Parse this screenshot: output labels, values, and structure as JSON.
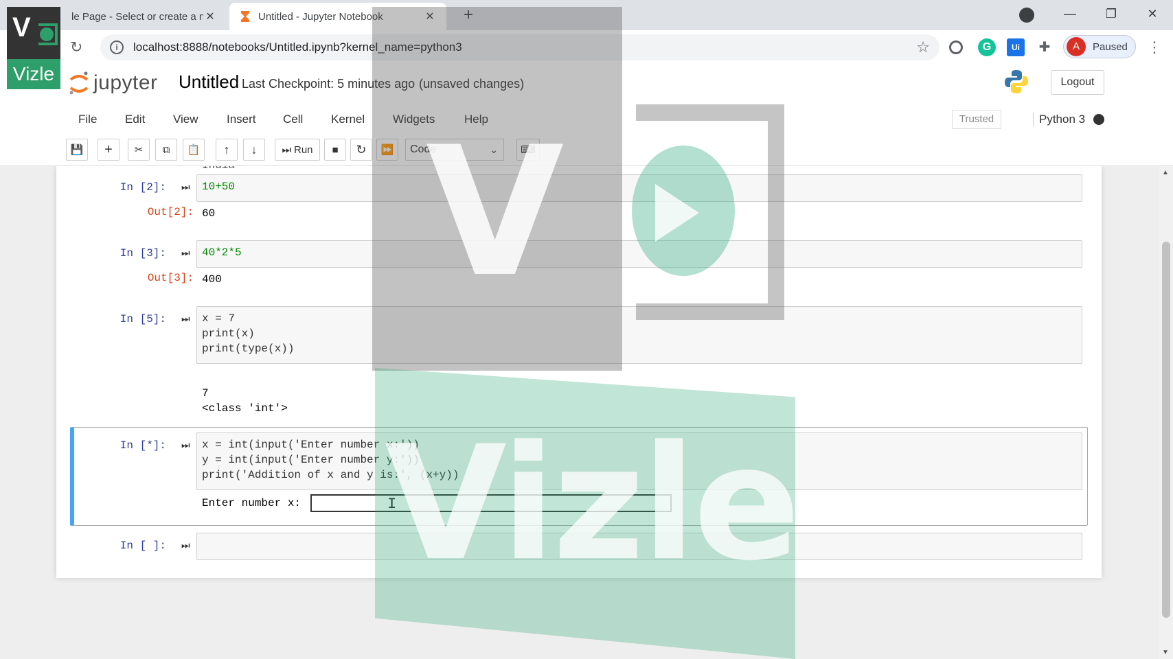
{
  "browser": {
    "tabs": [
      {
        "title": "le Page - Select or create a n",
        "active": false
      },
      {
        "title": "Untitled - Jupyter Notebook",
        "active": true
      }
    ],
    "url": "localhost:8888/notebooks/Untitled.ipynb?kernel_name=python3",
    "profile_status": "Paused",
    "profile_initial": "A"
  },
  "jupyter": {
    "logo_text": "jupyter",
    "notebook_title": "Untitled",
    "checkpoint": "Last Checkpoint: 5 minutes ago",
    "unsaved": "(unsaved changes)",
    "logout_label": "Logout",
    "menu": [
      "File",
      "Edit",
      "View",
      "Insert",
      "Cell",
      "Kernel",
      "Widgets",
      "Help"
    ],
    "trusted_label": "Trusted",
    "kernel_name": "Python 3",
    "toolbar": {
      "run_label": "Run",
      "cell_type": "Code"
    }
  },
  "cells": [
    {
      "prompt": "In [2]:",
      "code": [
        "10+50"
      ],
      "out_prompt": "Out[2]:",
      "output": "60"
    },
    {
      "prompt": "In [3]:",
      "code": [
        "40*2*5"
      ],
      "out_prompt": "Out[3]:",
      "output": "400"
    },
    {
      "prompt": "In [5]:",
      "code": [
        "x = 7",
        "print(x)",
        "print(type(x))"
      ],
      "stdout": [
        "7",
        "<class 'int'>"
      ]
    },
    {
      "prompt": "In [*]:",
      "code": [
        "x = int(input('Enter number x:'))",
        "y = int(input('Enter number y:'))",
        "print('Addition of x and y is:', (x+y))"
      ],
      "stdin_prompt": "Enter number x:"
    },
    {
      "prompt": "In [ ]:",
      "code": [
        ""
      ]
    }
  ],
  "partial_output_top": "India",
  "watermark": {
    "brand": "Vizle",
    "letter": "V"
  },
  "colors": {
    "selected_cell_bar": "#42a5f5",
    "in_prompt": "#303f9f",
    "out_prompt": "#d84315",
    "vizle_green": "#2e9e6a"
  }
}
